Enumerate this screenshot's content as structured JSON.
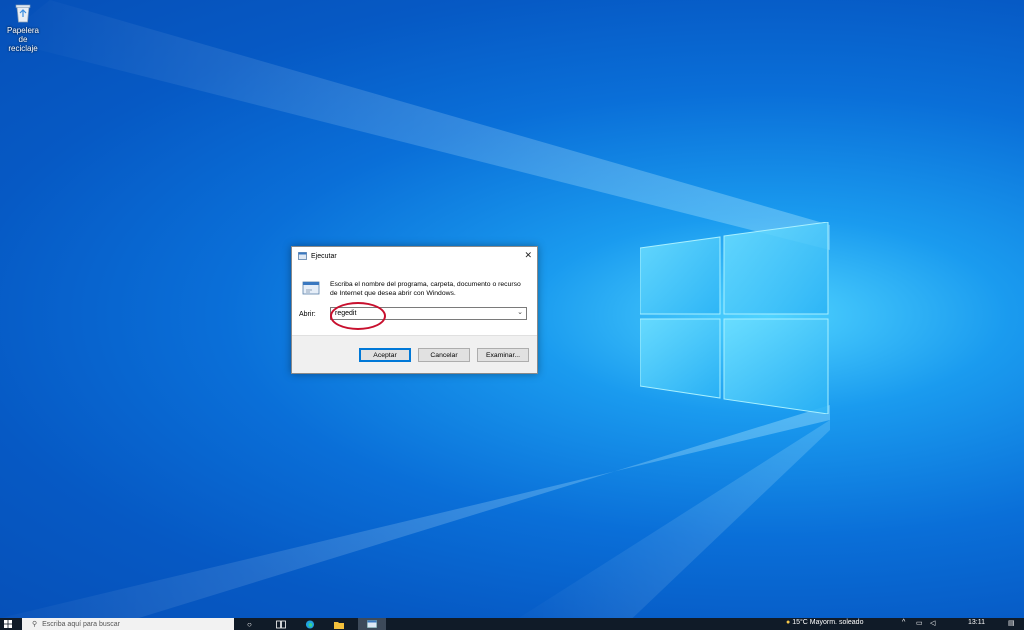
{
  "desktop": {
    "recycle_bin_label": "Papelera de reciclaje"
  },
  "dialog": {
    "title": "Ejecutar",
    "description": "Escriba el nombre del programa, carpeta, documento o recurso de Internet que desea abrir con Windows.",
    "open_label": "Abrir:",
    "open_value": "regedit",
    "ok_label": "Aceptar",
    "cancel_label": "Cancelar",
    "browse_label": "Examinar...",
    "highlight_color": "#c8102e"
  },
  "taskbar": {
    "search_placeholder": "Escriba aquí para buscar",
    "weather": "15°C  Mayorm. soleado",
    "time": "13:11",
    "icons": [
      "start-icon",
      "search-icon",
      "task-view-icon",
      "edge-icon",
      "file-explorer-icon",
      "run-app-icon"
    ]
  },
  "colors": {
    "accent": "#0078d7",
    "taskbar": "#101b28"
  }
}
